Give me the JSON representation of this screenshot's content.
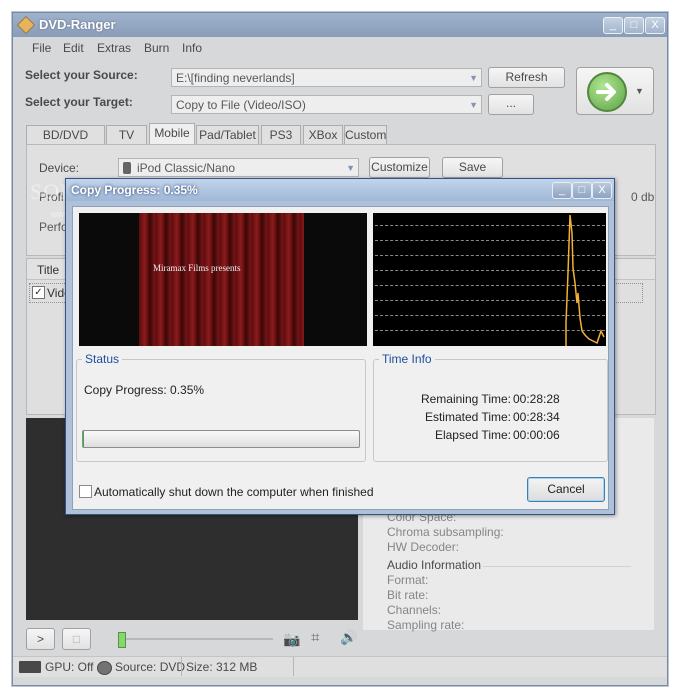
{
  "app": {
    "title": "DVD-Ranger",
    "window_buttons": [
      "_",
      "□",
      "X"
    ]
  },
  "menu": [
    "File",
    "Edit",
    "Extras",
    "Burn",
    "Info"
  ],
  "source": {
    "label": "Select your Source:",
    "value": "E:\\[finding neverlands]",
    "refresh_label": "Refresh"
  },
  "target": {
    "label": "Select your Target:",
    "value": "Copy to File (Video/ISO)",
    "browse_label": "..."
  },
  "tabs": [
    "BD/DVD Player",
    "TV",
    "Mobile",
    "Pad/Tablet",
    "PS3",
    "XBox",
    "Custom"
  ],
  "selected_tab": "Mobile",
  "device": {
    "label": "Device:",
    "value": "iPod Classic/Nano",
    "customize_label": "Customize",
    "save_label": "Save"
  },
  "partial": {
    "profile_label": "Profi",
    "perf_label": "Perfo",
    "db_text": "0 db",
    "title_header": "Title",
    "video_item": "Vide",
    "bg_watermark": "SOFTPEDIA",
    "bg_watermark_url": "www.softpedia.com"
  },
  "info": {
    "lines": [
      "Color Space:",
      "Chroma subsampling:",
      "HW Decoder:"
    ],
    "audio_title": "Audio Information",
    "audio_lines": [
      "Format:",
      "Bit rate:",
      "Channels:",
      "Sampling rate:"
    ]
  },
  "player": {
    "play_label": ">",
    "stop_label": "□"
  },
  "statusbar": {
    "gpu": "GPU: Off",
    "source": "Source: DVD",
    "size": "Size: 312 MB"
  },
  "dialog": {
    "title": "Copy Progress: 0.35%",
    "preview_text": "Miramax Films presents",
    "status_group": "Status",
    "progress_text": "Copy Progress: 0.35%",
    "progress_value": 0.0035,
    "time_group": "Time Info",
    "remaining_label": "Remaining Time:",
    "remaining_value": "00:28:28",
    "estimated_label": "Estimated Time:",
    "estimated_value": "00:28:34",
    "elapsed_label": "Elapsed Time:",
    "elapsed_value": "00:00:06",
    "shutdown_label": "Automatically shut down the computer when finished",
    "cancel_label": "Cancel"
  },
  "colors": {
    "accent": "#1d4f9c",
    "go_button": "#4da52a",
    "graph_line": "#f2b233"
  }
}
